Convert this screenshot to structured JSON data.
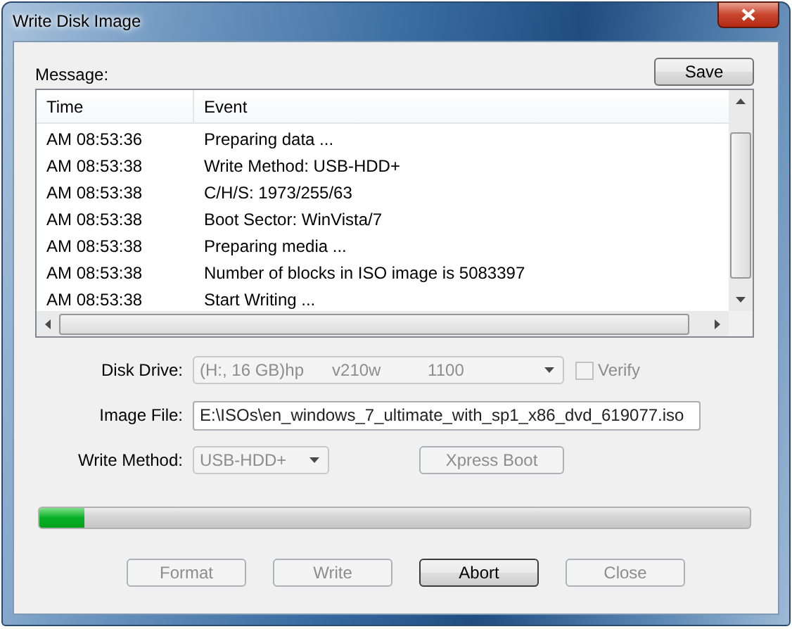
{
  "window": {
    "title": "Write Disk Image"
  },
  "message_label": "Message:",
  "save_button": {
    "label": "Save",
    "disabled": false
  },
  "log": {
    "columns": [
      "Time",
      "Event"
    ],
    "rows": [
      {
        "time": "AM 08:53:36",
        "event": "Preparing data ..."
      },
      {
        "time": "AM 08:53:38",
        "event": "Write Method: USB-HDD+"
      },
      {
        "time": "AM 08:53:38",
        "event": "C/H/S: 1973/255/63"
      },
      {
        "time": "AM 08:53:38",
        "event": "Boot Sector: WinVista/7"
      },
      {
        "time": "AM 08:53:38",
        "event": "Preparing media ..."
      },
      {
        "time": "AM 08:53:38",
        "event": "Number of blocks in ISO image is 5083397"
      },
      {
        "time": "AM 08:53:38",
        "event": "Start Writing ..."
      }
    ]
  },
  "disk_drive": {
    "label": "Disk Drive:",
    "value": "(H:, 16 GB)hp      v210w          1100",
    "disabled": true
  },
  "verify": {
    "label": "Verify",
    "checked": false,
    "disabled": true
  },
  "image_file": {
    "label": "Image File:",
    "value": "E:\\ISOs\\en_windows_7_ultimate_with_sp1_x86_dvd_619077.iso",
    "disabled": false
  },
  "write_method": {
    "label": "Write Method:",
    "value": "USB-HDD+",
    "disabled": true
  },
  "xpress_boot": {
    "label": "Xpress Boot",
    "disabled": true
  },
  "progress": {
    "level": 0.063
  },
  "buttons": [
    {
      "label": "Format",
      "disabled": true
    },
    {
      "label": "Write",
      "disabled": true
    },
    {
      "label": "Abort",
      "disabled": false
    },
    {
      "label": "Close",
      "disabled": true
    }
  ]
}
